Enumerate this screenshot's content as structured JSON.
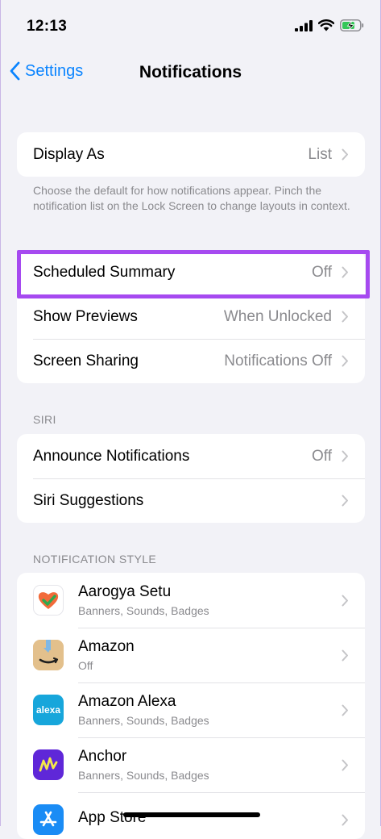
{
  "status_bar": {
    "time": "12:13"
  },
  "nav": {
    "back_label": "Settings",
    "title": "Notifications"
  },
  "display_group": {
    "display_as": {
      "label": "Display As",
      "value": "List"
    },
    "footer": "Choose the default for how notifications appear. Pinch the notification list on the Lock Screen to change layouts in context."
  },
  "preview_group": {
    "scheduled_summary": {
      "label": "Scheduled Summary",
      "value": "Off"
    },
    "show_previews": {
      "label": "Show Previews",
      "value": "When Unlocked"
    },
    "screen_sharing": {
      "label": "Screen Sharing",
      "value": "Notifications Off"
    }
  },
  "siri": {
    "header": "SIRI",
    "announce": {
      "label": "Announce Notifications",
      "value": "Off"
    },
    "suggestions": {
      "label": "Siri Suggestions"
    }
  },
  "notification_style": {
    "header": "NOTIFICATION STYLE",
    "apps": [
      {
        "name": "Aarogya Setu",
        "detail": "Banners, Sounds, Badges",
        "icon": "aarogya-setu-icon"
      },
      {
        "name": "Amazon",
        "detail": "Off",
        "icon": "amazon-icon"
      },
      {
        "name": "Amazon Alexa",
        "detail": "Banners, Sounds, Badges",
        "icon": "alexa-icon",
        "icon_text": "alexa"
      },
      {
        "name": "Anchor",
        "detail": "Banners, Sounds, Badges",
        "icon": "anchor-icon"
      },
      {
        "name": "App Store",
        "detail": "",
        "icon": "app-store-icon"
      }
    ]
  },
  "colors": {
    "accent": "#0a84ff",
    "highlight": "#a64af0",
    "background": "#f2f2f7",
    "secondary_text": "#8a8a8e"
  }
}
